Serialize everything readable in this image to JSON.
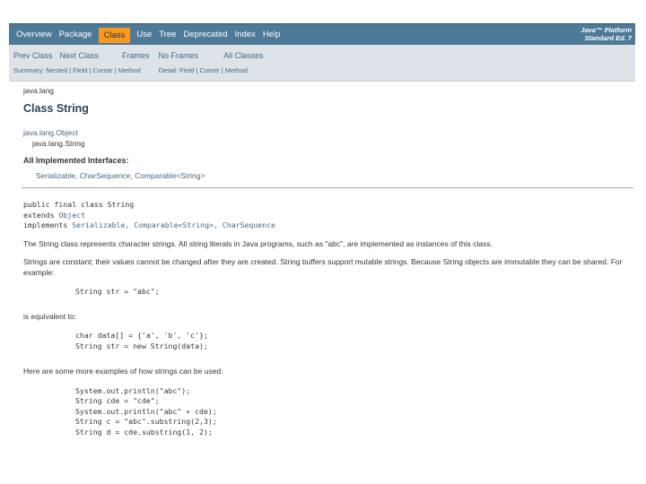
{
  "top_nav": {
    "items": [
      "Overview",
      "Package",
      "Class",
      "Use",
      "Tree",
      "Deprecated",
      "Index",
      "Help"
    ],
    "active": "Class",
    "about_line1": "Java™ Platform",
    "about_line2": "Standard Ed. 7"
  },
  "sub_nav": {
    "row1": [
      "Prev Class",
      "Next Class",
      "Frames",
      "No Frames",
      "All Classes"
    ],
    "summary_label": "Summary:",
    "summary_links": [
      "Nested",
      "Field",
      "Constr",
      "Method"
    ],
    "detail_label": "Detail:",
    "detail_links": [
      "Field",
      "Constr",
      "Method"
    ]
  },
  "content": {
    "package": "java.lang",
    "class_title": "Class String",
    "inherit_parent": "java.lang.Object",
    "inherit_child": "java.lang.String",
    "impl_heading": "All Implemented Interfaces:",
    "impl_list": "Serializable, CharSequence, Comparable<String>",
    "sig_line1": "public final class String",
    "sig_line2_kw": "extends ",
    "sig_line2_link": "Object",
    "sig_line3_kw": "implements ",
    "sig_line3_links": "Serializable, Comparable<String>, CharSequence",
    "desc1": "The String class represents character strings. All string literals in Java programs, such as \"abc\", are implemented as instances of this class.",
    "desc2": "Strings are constant; their values cannot be changed after they are created. String buffers support mutable strings. Because String objects are immutable they can be shared. For example:",
    "code1": "String str = \"abc\";",
    "desc3": "is equivalent to:",
    "code2_line1": "char data[] = {'a', 'b', 'c'};",
    "code2_line2": "String str = new String(data);",
    "desc4": "Here are some more examples of how strings can be used:",
    "code3": [
      "System.out.println(\"abc\");",
      "String cde = \"cde\";",
      "System.out.println(\"abc\" + cde);",
      "String c = \"abc\".substring(2,3);",
      "String d = cde.substring(1, 2);"
    ]
  }
}
